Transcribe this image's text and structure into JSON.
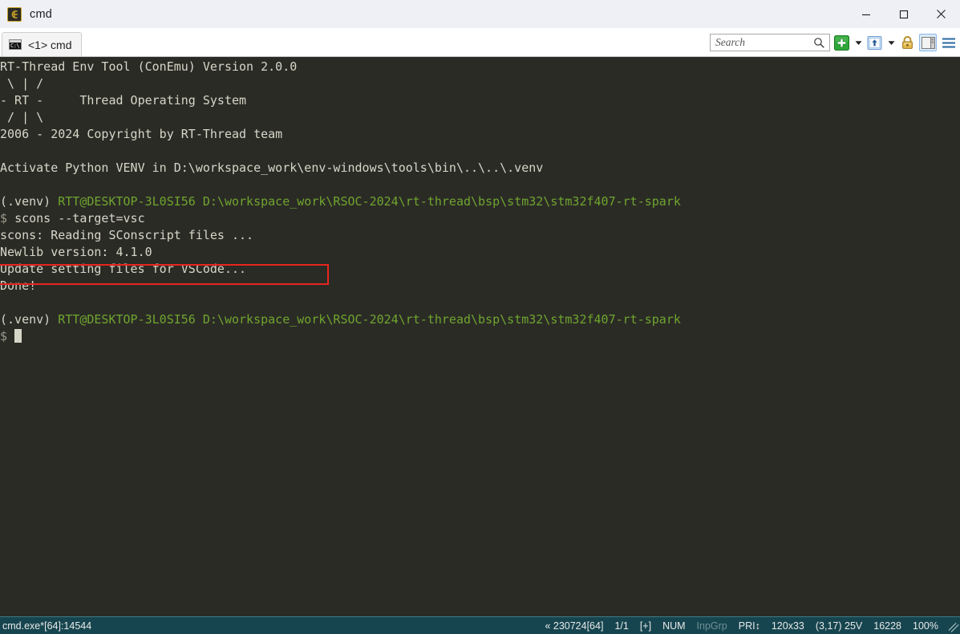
{
  "window": {
    "title": "cmd",
    "app_icon": "conemu-logo-icon",
    "controls": {
      "minimize": "minimize-icon",
      "maximize": "maximize-icon",
      "close": "close-icon"
    }
  },
  "tabbar": {
    "tabs": [
      {
        "label": "<1> cmd",
        "icon": "console-icon"
      }
    ]
  },
  "toolbar": {
    "search": {
      "placeholder": "Search",
      "value": ""
    },
    "search_icon": "search-icon",
    "new_console_icon": "plus-green-icon",
    "new_console_caret": "chevron-down-icon",
    "active_console_icon": "console-up-arrow-icon",
    "active_console_caret": "chevron-down-icon",
    "lock_icon": "padlock-icon",
    "layout_icon": "split-panel-icon",
    "menu_icon": "hamburger-menu-icon"
  },
  "terminal": {
    "colors": {
      "background": "#2B2B26",
      "foreground": "#D6D6C8",
      "green": "#6FA52E",
      "prompt_dim": "#9A9A8C",
      "highlight": "#E8251F"
    },
    "lines": [
      {
        "id": "l01",
        "segments": [
          {
            "text": "RT-Thread Env Tool (ConEmu) Version 2.0.0",
            "color": "fg"
          }
        ]
      },
      {
        "id": "l02",
        "segments": [
          {
            "text": " \\ | /",
            "color": "fg"
          }
        ]
      },
      {
        "id": "l03",
        "segments": [
          {
            "text": "- RT -     Thread Operating System",
            "color": "fg"
          }
        ]
      },
      {
        "id": "l04",
        "segments": [
          {
            "text": " / | \\",
            "color": "fg"
          }
        ]
      },
      {
        "id": "l05",
        "segments": [
          {
            "text": "2006 - 2024 Copyright by RT-Thread team",
            "color": "fg"
          }
        ]
      },
      {
        "id": "l06",
        "segments": [
          {
            "text": "",
            "color": "fg"
          }
        ]
      },
      {
        "id": "l07",
        "segments": [
          {
            "text": "Activate Python VENV in D:\\workspace_work\\env-windows\\tools\\bin\\..\\..\\.venv",
            "color": "fg"
          }
        ]
      },
      {
        "id": "l08",
        "segments": [
          {
            "text": "",
            "color": "fg"
          }
        ]
      },
      {
        "id": "l09",
        "segments": [
          {
            "text": "(.venv) ",
            "color": "fg"
          },
          {
            "text": "RTT@DESKTOP-3L0SI56 D:\\workspace_work\\RSOC-2024\\rt-thread\\bsp\\stm32\\stm32f407-rt-spark",
            "color": "green"
          }
        ]
      },
      {
        "id": "l10",
        "segments": [
          {
            "text": "$ ",
            "color": "dim"
          },
          {
            "text": "scons --target=vsc",
            "color": "fg"
          }
        ]
      },
      {
        "id": "l11",
        "segments": [
          {
            "text": "scons: Reading SConscript files ...",
            "color": "fg"
          }
        ]
      },
      {
        "id": "l12",
        "segments": [
          {
            "text": "Newlib version: 4.1.0",
            "color": "fg"
          }
        ]
      },
      {
        "id": "l13",
        "segments": [
          {
            "text": "Update setting files for VSCode...",
            "color": "fg"
          }
        ]
      },
      {
        "id": "l14",
        "segments": [
          {
            "text": "Done!",
            "color": "fg"
          }
        ]
      },
      {
        "id": "l15",
        "segments": [
          {
            "text": "",
            "color": "fg"
          }
        ]
      },
      {
        "id": "l16",
        "segments": [
          {
            "text": "(.venv) ",
            "color": "fg"
          },
          {
            "text": "RTT@DESKTOP-3L0SI56 D:\\workspace_work\\RSOC-2024\\rt-thread\\bsp\\stm32\\stm32f407-rt-spark",
            "color": "green"
          }
        ]
      },
      {
        "id": "l17",
        "segments": [
          {
            "text": "$ ",
            "color": "dim"
          }
        ],
        "cursor": true
      }
    ],
    "annotation": {
      "type": "red-rectangle",
      "target_text": "$ scons --target=vsc"
    }
  },
  "statusbar": {
    "process": "cmd.exe*[64]:14544",
    "cells": [
      {
        "name": "build-id",
        "text": "« 230724[64]",
        "dim": false
      },
      {
        "name": "page-indicator",
        "text": "1/1",
        "dim": false
      },
      {
        "name": "insert-mode",
        "text": "[+]",
        "dim": false
      },
      {
        "name": "num-lock",
        "text": "NUM",
        "dim": false
      },
      {
        "name": "input-group",
        "text": "InpGrp",
        "dim": true
      },
      {
        "name": "priority",
        "text": "PRI↕",
        "dim": false
      },
      {
        "name": "console-size",
        "text": "120x33",
        "dim": false
      },
      {
        "name": "cursor-position",
        "text": "(3,17) 25V",
        "dim": false
      },
      {
        "name": "memory",
        "text": "16228",
        "dim": false
      },
      {
        "name": "zoom-level",
        "text": "100%",
        "dim": false
      }
    ]
  }
}
